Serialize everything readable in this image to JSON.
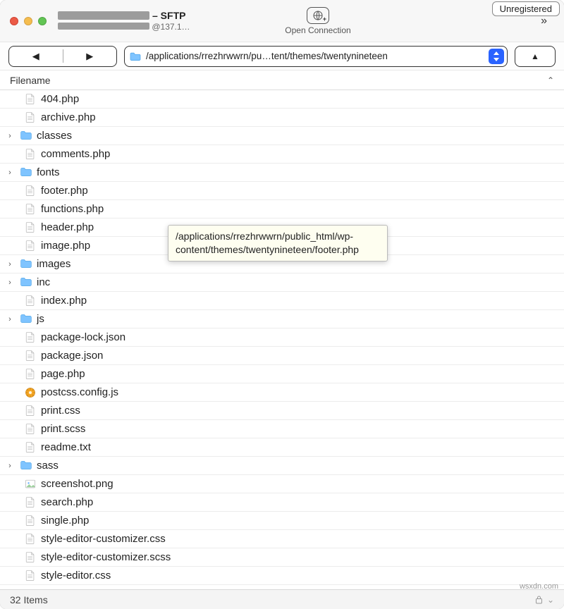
{
  "titlebar": {
    "suffix": " – SFTP",
    "sub_prefix": "@137.1…",
    "open_connection_label": "Open Connection",
    "badge": "Unregistered",
    "overflow_glyph": "»"
  },
  "nav": {
    "back_glyph": "◀",
    "fwd_glyph": "▶",
    "up_glyph": "▲",
    "path_display": "/applications/rrezhrwwrn/pu…tent/themes/twentynineteen"
  },
  "columns": {
    "filename_label": "Filename",
    "sort_caret": "⌃"
  },
  "tooltip": {
    "text": "/applications/rrezhrwwrn/public_html/wp-content/themes/twentynineteen/footer.php"
  },
  "footer": {
    "item_count": "32 Items",
    "lock_caret": "⌄"
  },
  "watermark": "wsxdn.com",
  "files": [
    {
      "name": "404.php",
      "kind": "file",
      "expandable": false
    },
    {
      "name": "archive.php",
      "kind": "file",
      "expandable": false
    },
    {
      "name": "classes",
      "kind": "folder",
      "expandable": true
    },
    {
      "name": "comments.php",
      "kind": "file",
      "expandable": false
    },
    {
      "name": "fonts",
      "kind": "folder",
      "expandable": true
    },
    {
      "name": "footer.php",
      "kind": "file",
      "expandable": false
    },
    {
      "name": "functions.php",
      "kind": "file",
      "expandable": false
    },
    {
      "name": "header.php",
      "kind": "file",
      "expandable": false
    },
    {
      "name": "image.php",
      "kind": "file",
      "expandable": false
    },
    {
      "name": "images",
      "kind": "folder",
      "expandable": true
    },
    {
      "name": "inc",
      "kind": "folder",
      "expandable": true
    },
    {
      "name": "index.php",
      "kind": "file",
      "expandable": false
    },
    {
      "name": "js",
      "kind": "folder",
      "expandable": true
    },
    {
      "name": "package-lock.json",
      "kind": "file",
      "expandable": false
    },
    {
      "name": "package.json",
      "kind": "file",
      "expandable": false
    },
    {
      "name": "page.php",
      "kind": "file",
      "expandable": false
    },
    {
      "name": "postcss.config.js",
      "kind": "config",
      "expandable": false
    },
    {
      "name": "print.css",
      "kind": "file",
      "expandable": false
    },
    {
      "name": "print.scss",
      "kind": "file",
      "expandable": false
    },
    {
      "name": "readme.txt",
      "kind": "file",
      "expandable": false
    },
    {
      "name": "sass",
      "kind": "folder",
      "expandable": true
    },
    {
      "name": "screenshot.png",
      "kind": "image",
      "expandable": false
    },
    {
      "name": "search.php",
      "kind": "file",
      "expandable": false
    },
    {
      "name": "single.php",
      "kind": "file",
      "expandable": false
    },
    {
      "name": "style-editor-customizer.css",
      "kind": "file",
      "expandable": false
    },
    {
      "name": "style-editor-customizer.scss",
      "kind": "file",
      "expandable": false
    },
    {
      "name": "style-editor.css",
      "kind": "file",
      "expandable": false
    }
  ]
}
